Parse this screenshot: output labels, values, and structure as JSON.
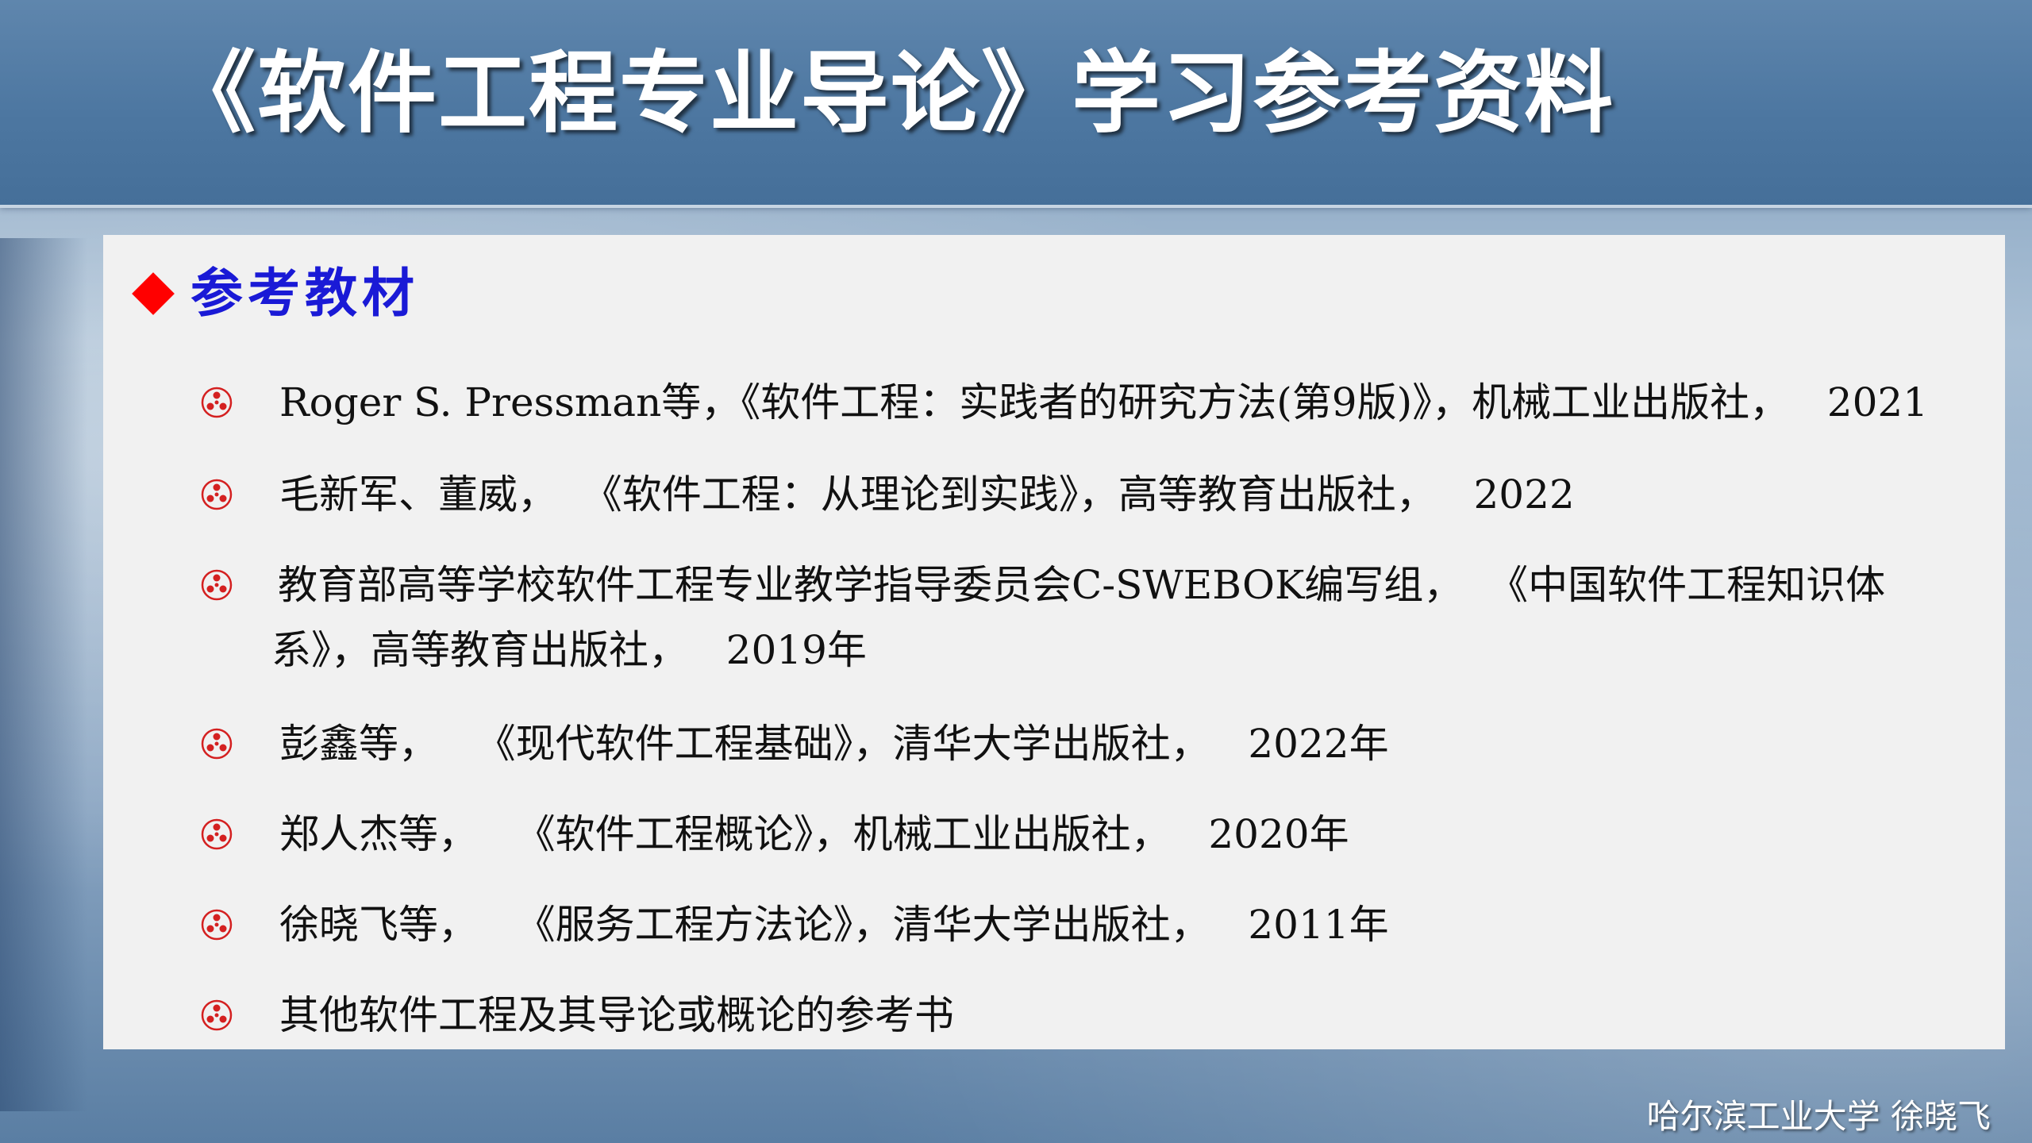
{
  "slide": {
    "title": "《软件工程专业导论》学习参考资料",
    "section": {
      "icon": "red-diamond-bullet-icon",
      "title": "参考教材"
    },
    "bullet_icon": "red-trefoil-bullet-icon",
    "items": [
      {
        "text": "Roger S. Pressman等，《软件工程：实践者的研究方法(第9版)》，机械工业出版社，   2021"
      },
      {
        "text": "毛新军、董威，  《软件工程：从理论到实践》，高等教育出版社，   2022"
      },
      {
        "text": "教育部高等学校软件工程专业教学指导委员会C-SWEBOK编写组，  《中国软件工程知识体系》，高等教育出版社，   2019年"
      },
      {
        "text": "彭鑫等，   《现代软件工程基础》，清华大学出版社，   2022年"
      },
      {
        "text": "郑人杰等，   《软件工程概论》，机械工业出版社，   2020年"
      },
      {
        "text": "徐晓飞等，   《服务工程方法论》，清华大学出版社，   2011年"
      },
      {
        "text": "其他软件工程及其导论或概论的参考书"
      }
    ],
    "footer": "哈尔滨工业大学  徐晓飞"
  },
  "colors": {
    "header": "#4d77a1",
    "panel": "#f1f1f1",
    "section_title": "#1a1ad6",
    "diamond": "#ff0000",
    "bullet": "#d42020"
  }
}
